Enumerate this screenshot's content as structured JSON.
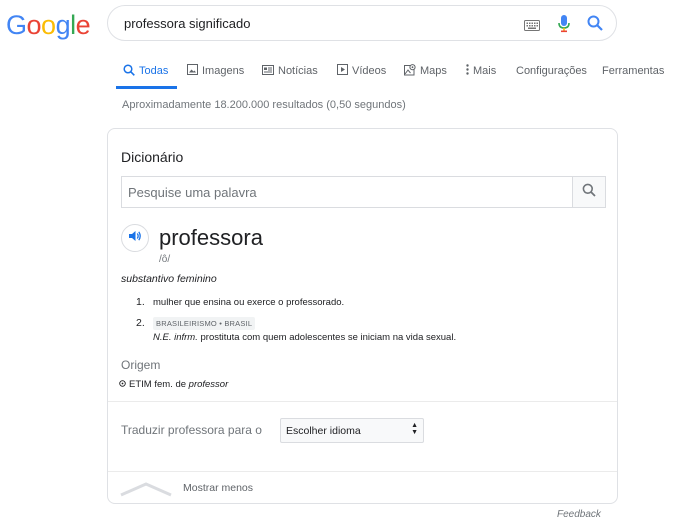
{
  "logo": {
    "letters": [
      "G",
      "o",
      "o",
      "g",
      "l",
      "e"
    ],
    "colors": [
      "#4285F4",
      "#EA4335",
      "#FBBC05",
      "#4285F4",
      "#34A853",
      "#EA4335"
    ]
  },
  "search": {
    "query": "professora significado"
  },
  "tabs": [
    {
      "label": "Todas",
      "icon": "search-icon",
      "active": true
    },
    {
      "label": "Imagens",
      "icon": "image-icon"
    },
    {
      "label": "Notícias",
      "icon": "news-icon"
    },
    {
      "label": "Vídeos",
      "icon": "video-icon"
    },
    {
      "label": "Maps",
      "icon": "map-icon"
    },
    {
      "label": "Mais",
      "icon": "more-vert-icon"
    },
    {
      "label": "Configurações"
    },
    {
      "label": "Ferramentas"
    }
  ],
  "stats": "Aproximadamente 18.200.000 resultados (0,50 segundos)",
  "dictionary": {
    "title": "Dicionário",
    "search_placeholder": "Pesquise uma palavra",
    "word": "professora",
    "phonetic": "/ô/",
    "part_of_speech": "substantivo feminino",
    "definitions": [
      {
        "num": "1.",
        "text": "mulher que ensina ou exerce o professorado."
      },
      {
        "num": "2.",
        "badge": "BRASILEIRISMO • BRASIL",
        "abbr": "N.E. infrm.",
        "text": " prostituta com quem adolescentes se iniciam na vida sexual."
      }
    ],
    "origin_title": "Origem",
    "etym_prefix": "ETIM fem. de ",
    "etym_word": "professor",
    "translate_label": "Traduzir professora para o",
    "translate_select": "Escolher idioma",
    "show_less": "Mostrar menos"
  },
  "feedback": "Feedback",
  "accent": "#1a73e8"
}
